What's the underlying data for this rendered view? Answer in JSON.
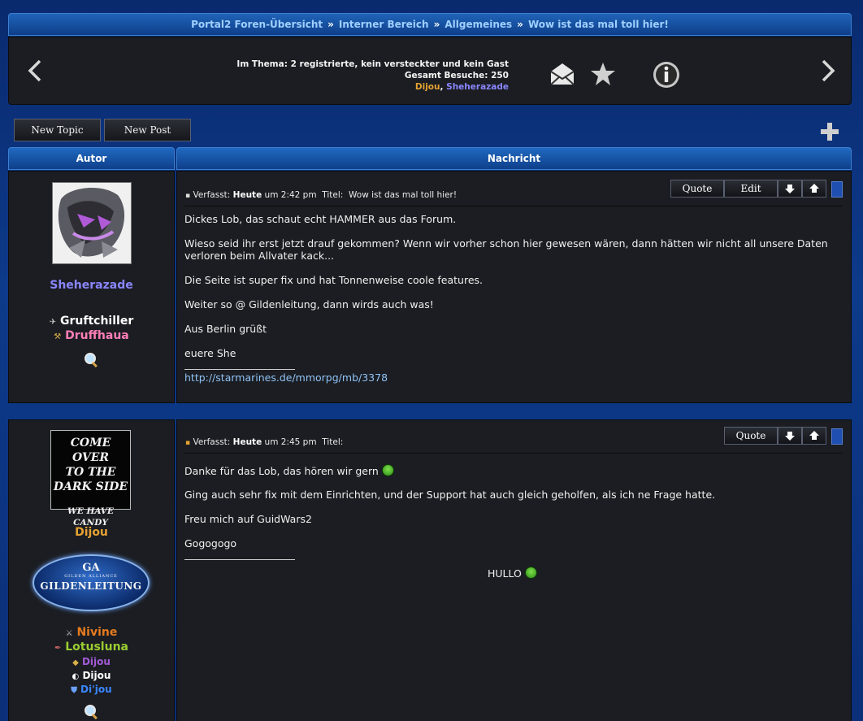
{
  "breadcrumb": {
    "items": [
      "Portal2 Foren-Übersicht",
      "Interner Bereich",
      "Allgemeines",
      "Wow ist das mal toll hier!"
    ],
    "separator": "»"
  },
  "stats": {
    "line1": "Im Thema: 2 registrierte, kein versteckter und kein Gast",
    "line2": "Gesamt Besuche: 250",
    "users": [
      "Dijou",
      "Sheherazade"
    ],
    "comma": ","
  },
  "toolbar": {
    "new_topic": "New Topic",
    "new_post": "New Post"
  },
  "headers": {
    "author": "Autor",
    "message": "Nachricht"
  },
  "post1": {
    "author": "Sheherazade",
    "chars": [
      "Gruftchiller",
      "Druffhaua"
    ],
    "meta_label": "Verfasst:",
    "meta_day": "Heute",
    "meta_time": "um 2:42 pm",
    "meta_title_label": "Titel:",
    "meta_title": "Wow ist das mal toll hier!",
    "buttons": {
      "quote": "Quote",
      "edit": "Edit"
    },
    "lines": [
      "Dickes Lob, das schaut echt HAMMER aus das Forum.",
      "Wieso seid ihr erst jetzt drauf gekommen? Wenn wir vorher schon hier gewesen wären, dann hätten wir nicht all unsere Daten",
      "verloren beim Allvater kack...",
      "Die Seite ist super fix und hat Tonnenweise coole features.",
      "Weiter so @ Gildenleitung, dann wirds auch was!",
      "Aus Berlin grüßt",
      "euere She"
    ],
    "sig_link": "http://starmarines.de/mmorpg/mb/3378"
  },
  "post2": {
    "author": "Dijou",
    "avatar_lines": [
      "COME OVER",
      "TO THE",
      "DARK SIDE",
      "WE HAVE CANDY"
    ],
    "rank_badge": {
      "small": "GA",
      "tiny": "GILDEN ALLIANCE",
      "big": "GILDENLEITUNG"
    },
    "chars": [
      "Nivine",
      "Lotusluna",
      "Dijou",
      "Dijou",
      "Di'jou"
    ],
    "meta_label": "Verfasst:",
    "meta_day": "Heute",
    "meta_time": "um 2:45 pm",
    "meta_title_label": "Titel:",
    "buttons": {
      "quote": "Quote"
    },
    "lines": [
      "Danke für das Lob, das hören wir gern",
      "Ging auch sehr fix mit dem Einrichten, und der Support hat auch gleich geholfen, als ich ne Frage hatte.",
      "Freu mich auf GuidWars2",
      "Gogogogo"
    ],
    "sig_text": "HULLO"
  },
  "colors": {
    "dijou": "#e6a232",
    "sheherazade": "#8a86ff",
    "gruftchiller": "#ffffff",
    "druffhaua": "#ff7fb8",
    "nivine": "#e57a1e",
    "lotusluna": "#9acd32",
    "dijou_purple": "#a35bd8",
    "dijou_white": "#ffffff",
    "dijou_blue": "#3a86ff"
  }
}
